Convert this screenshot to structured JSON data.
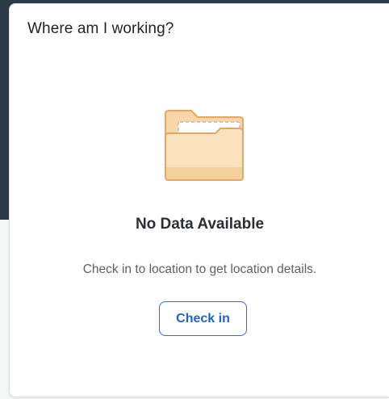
{
  "card": {
    "title": "Where am I working?",
    "empty_state": {
      "icon": "folder-icon",
      "title": "No Data Available",
      "description": "Check in to location to get location details.",
      "action_label": "Check in"
    }
  },
  "colors": {
    "backdrop_dark": "#2b3a46",
    "folder_fill": "#f8d6a8",
    "folder_stroke": "#e3a766",
    "accent": "#2b6fd1"
  }
}
